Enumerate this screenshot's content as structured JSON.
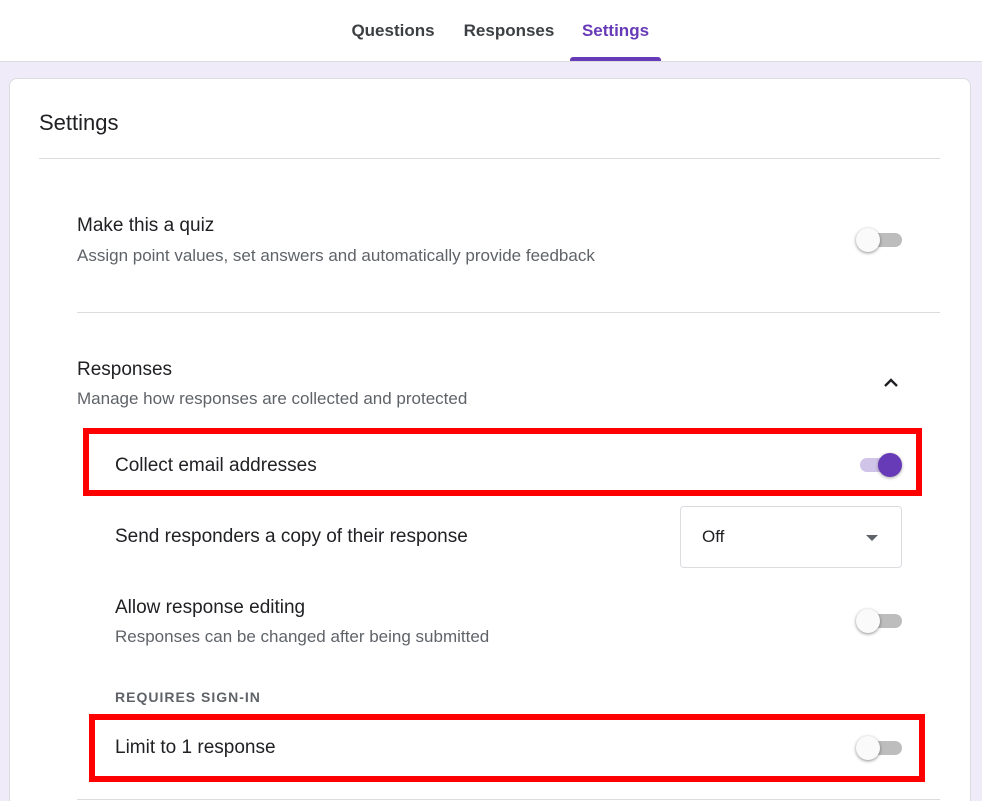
{
  "tabs": {
    "questions": "Questions",
    "responses": "Responses",
    "settings": "Settings"
  },
  "active_tab": "Settings",
  "page_title": "Settings",
  "quiz": {
    "title": "Make this a quiz",
    "description": "Assign point values, set answers and automatically provide feedback",
    "enabled": false
  },
  "responses_section": {
    "title": "Responses",
    "description": "Manage how responses are collected and protected",
    "expanded": true,
    "collect_email": {
      "label": "Collect email addresses",
      "enabled": true
    },
    "send_copy": {
      "label": "Send responders a copy of their response",
      "value": "Off"
    },
    "allow_editing": {
      "label": "Allow response editing",
      "description": "Responses can be changed after being submitted",
      "enabled": false
    },
    "requires_signin_label": "REQUIRES SIGN-IN",
    "limit_one": {
      "label": "Limit to 1 response",
      "enabled": false
    }
  },
  "colors": {
    "accent": "#673ab7",
    "background": "#f0ebf8",
    "highlight": "#ff0000"
  }
}
